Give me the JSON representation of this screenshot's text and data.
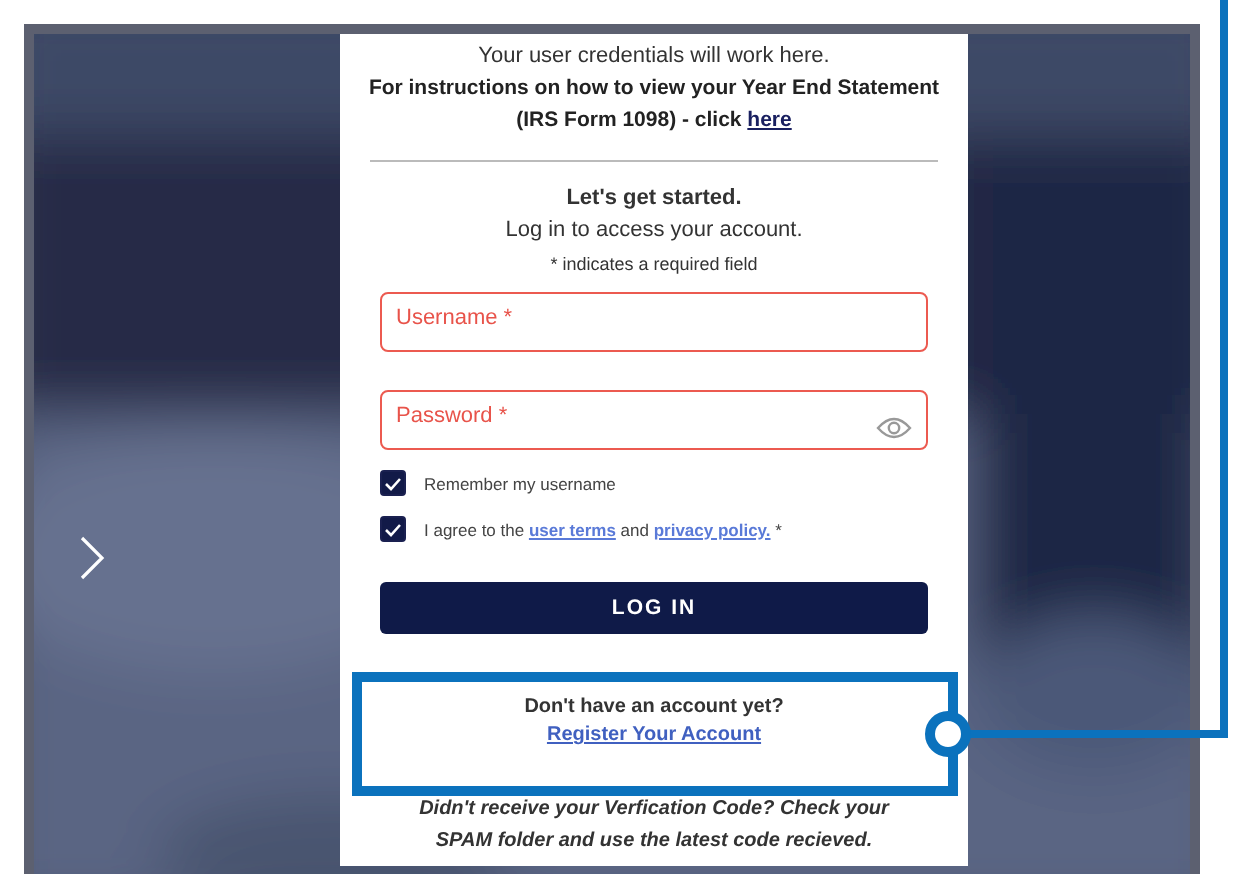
{
  "notice": "Your user credentials will work here.",
  "instructions": [
    {
      "kind": "text",
      "text": "For instructions on how to view your Year End Statement (IRS Form 1098) - click "
    },
    {
      "kind": "link",
      "text": "here"
    }
  ],
  "heading": "Let's get started.",
  "subheading": "Log in to access your account.",
  "required_note": "* indicates a required field",
  "fields": [
    {
      "kind": "text",
      "placeholder": "Username *"
    },
    {
      "kind": "password",
      "placeholder": "Password *"
    }
  ],
  "checkboxes": [
    {
      "checked": true,
      "parts": [
        {
          "kind": "text",
          "text": "Remember my username"
        }
      ]
    },
    {
      "checked": true,
      "parts": [
        {
          "kind": "text",
          "text": "I agree to the "
        },
        {
          "kind": "link",
          "text": "user terms"
        },
        {
          "kind": "text",
          "text": " and "
        },
        {
          "kind": "link",
          "text": "privacy policy."
        },
        {
          "kind": "text",
          "text": " *"
        }
      ]
    }
  ],
  "login_button": "LOG IN",
  "register": {
    "prompt": "Don't have an account yet?",
    "link": "Register Your Account"
  },
  "verification_note": "Didn't receive your Verfication Code?  Check your SPAM folder and use the latest code recieved."
}
